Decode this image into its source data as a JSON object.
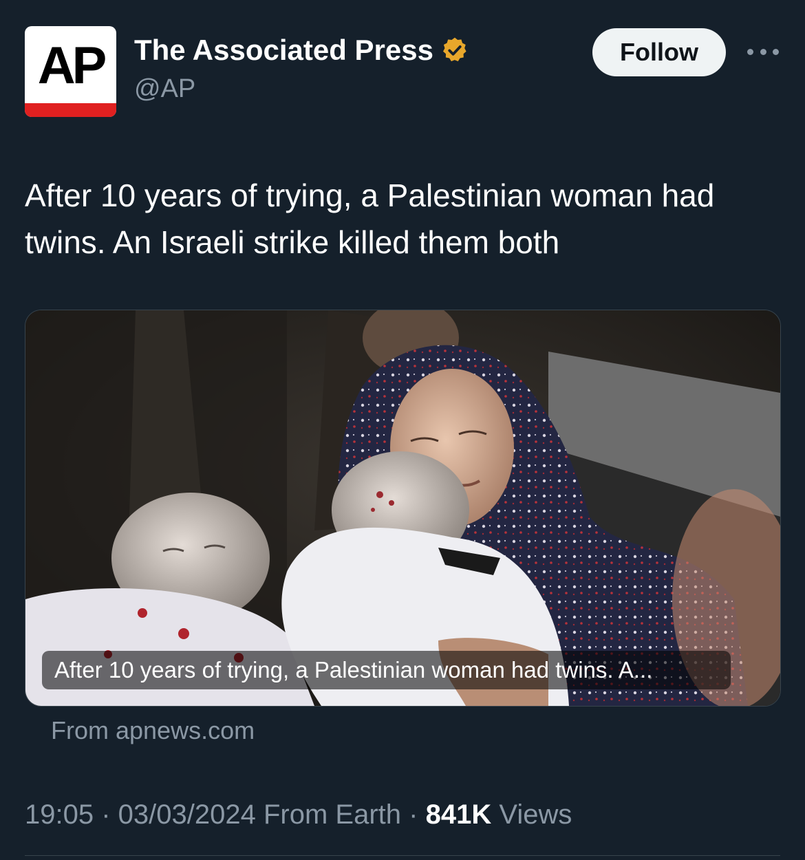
{
  "author": {
    "logo_text": "AP",
    "display_name": "The Associated Press",
    "handle": "@AP",
    "verified": true,
    "verified_color": "#e8a72b"
  },
  "actions": {
    "follow_label": "Follow",
    "more_icon": "more-horizontal-icon"
  },
  "tweet": {
    "text": "After 10 years of trying, a Palestinian woman had twins. An Israeli strike killed them both"
  },
  "link_card": {
    "title": "After 10 years of trying, a Palestinian woman had twins. A...",
    "source": "From apnews.com"
  },
  "meta": {
    "time": "19:05",
    "date": "03/03/2024",
    "origin": "From Earth",
    "views_count": "841K",
    "views_label": "Views"
  },
  "colors": {
    "background": "#15202b",
    "secondary_text": "#8b98a5",
    "ap_red": "#e02020"
  }
}
